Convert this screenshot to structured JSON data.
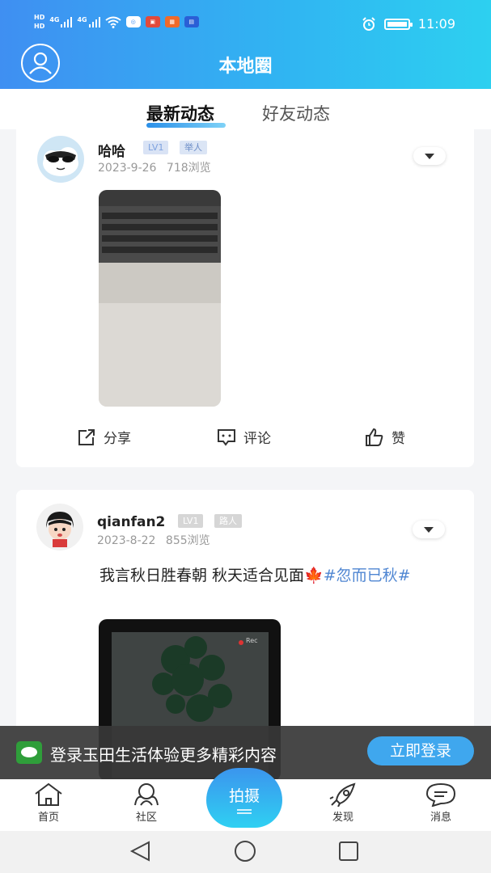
{
  "status_bar": {
    "left_hd1": "HD",
    "left_hd2": "HD",
    "signal1": "4G",
    "signal2": "4G",
    "time": "11:09",
    "icons": [
      "alarm-icon",
      "battery-icon",
      "wifi-icon"
    ]
  },
  "header": {
    "title": "本地圈",
    "bg_colors": [
      "#3f8ff2",
      "#2dd0f0"
    ]
  },
  "tabs": [
    {
      "label": "最新动态",
      "active": true
    },
    {
      "label": "好友动态",
      "active": false
    }
  ],
  "posts": [
    {
      "username": "哈哈",
      "level": "LV1",
      "role": "举人",
      "date": "2023-9-26",
      "views": "718浏览",
      "actions": {
        "share": "分享",
        "comment": "评论",
        "like": "赞"
      }
    },
    {
      "username": "qianfan2",
      "level": "LV1",
      "role": "路人",
      "date": "2023-8-22",
      "views": "855浏览",
      "text": "我言秋日胜春朝 秋天适合见面🍁",
      "tag": "#忽而已秋#",
      "media_overlay": "Rec"
    }
  ],
  "login_banner": {
    "text": "登录玉田生活体验更多精彩内容",
    "button": "立即登录"
  },
  "bottom_nav": {
    "items": [
      {
        "label": "首页",
        "icon": "home-icon"
      },
      {
        "label": "社区",
        "icon": "community-icon"
      },
      {
        "label": "发现",
        "icon": "rocket-icon"
      },
      {
        "label": "消息",
        "icon": "message-icon"
      }
    ],
    "center": "拍摄"
  },
  "accent": "#3fa7ee"
}
